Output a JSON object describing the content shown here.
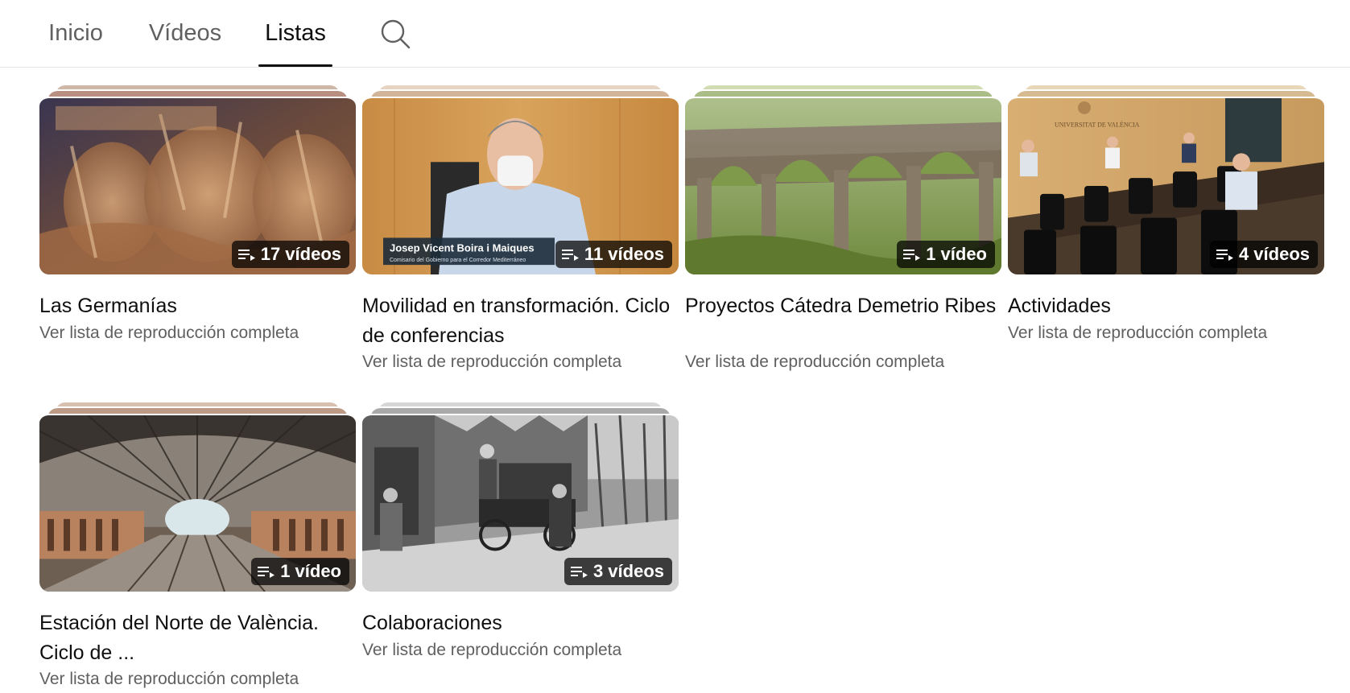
{
  "tabs": {
    "home": "Inicio",
    "videos": "Vídeos",
    "playlists": "Listas"
  },
  "icons": {
    "search": "search-icon",
    "playlist": "playlist-icon"
  },
  "colors": {
    "text_primary": "#0f0f0f",
    "text_secondary": "#606060",
    "badge_bg": "#000000b8"
  },
  "playlists": [
    {
      "title": "Las Germanías",
      "count": "17 vídeos",
      "link": "Ver lista de reproducción completa"
    },
    {
      "title": "Movilidad en transformación. Ciclo de conferencias",
      "count": "11 vídeos",
      "link": "Ver lista de reproducción completa",
      "overlay_name": "Josep Vicent Boira i Maiques",
      "overlay_role": "Comisario del Gobierno para el Corredor Mediterráneo"
    },
    {
      "title": "Proyectos Cátedra Demetrio Ribes",
      "count": "1 vídeo",
      "link": "Ver lista de reproducción completa"
    },
    {
      "title": "Actividades",
      "count": "4 vídeos",
      "link": "Ver lista de reproducción completa",
      "sign": "UNIVERSITAT DE VALÈNCIA"
    },
    {
      "title": "Estación del Norte de València. Ciclo de ...",
      "count": "1 vídeo",
      "link": "Ver lista de reproducción completa"
    },
    {
      "title": "Colaboraciones",
      "count": "3 vídeos",
      "link": "Ver lista de reproducción completa"
    }
  ]
}
